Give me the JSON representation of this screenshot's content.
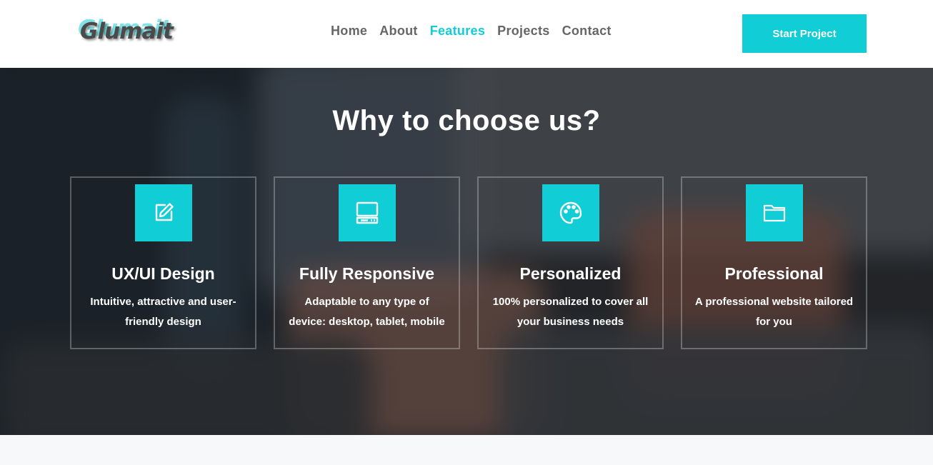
{
  "brand": {
    "logo_text": "Glumait"
  },
  "nav": {
    "items": [
      {
        "label": "Home",
        "active": false
      },
      {
        "label": "About",
        "active": false
      },
      {
        "label": "Features",
        "active": true
      },
      {
        "label": "Projects",
        "active": false
      },
      {
        "label": "Contact",
        "active": false
      }
    ]
  },
  "header": {
    "cta_label": "Start Project"
  },
  "hero": {
    "title": "Why to choose us?",
    "features": [
      {
        "icon": "edit-icon",
        "title": "UX/UI Design",
        "description": "Intuitive, attractive and user-friendly design"
      },
      {
        "icon": "monitor-icon",
        "title": "Fully Responsive",
        "description": "Adaptable to any type of device: desktop, tablet, mobile"
      },
      {
        "icon": "palette-icon",
        "title": "Personalized",
        "description": "100% personalized to cover all your business needs"
      },
      {
        "icon": "folder-icon",
        "title": "Professional",
        "description": "A professional website tailored for you"
      }
    ]
  },
  "colors": {
    "accent": "#11cdd6",
    "nav_text": "#666666",
    "header_bg": "#ffffff",
    "page_bg": "#f7f8fa"
  }
}
